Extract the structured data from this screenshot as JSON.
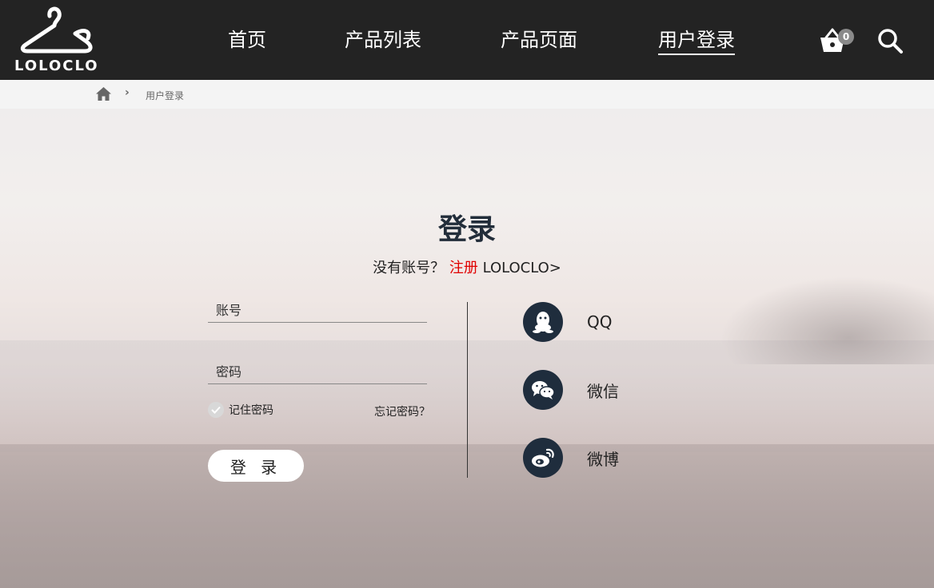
{
  "header": {
    "logo_text": "LOLOCLO",
    "nav": [
      {
        "label": "首页"
      },
      {
        "label": "产品列表"
      },
      {
        "label": "产品页面"
      },
      {
        "label": "用户登录",
        "active": true
      }
    ],
    "cart_count": "0",
    "icons": [
      "hanger-logo-icon",
      "basket-icon",
      "search-icon"
    ]
  },
  "breadcrumb": {
    "home_icon": "home-icon",
    "separator": "›",
    "current": "用户登录"
  },
  "login": {
    "title": "登录",
    "subtitle_prefix": "没有账号？",
    "register_link": "注册",
    "brand_link": "LOLOCLO>",
    "account_placeholder": "账号",
    "password_placeholder": "密码",
    "remember_label": "记住密码",
    "forgot_link": "忘记密码？",
    "submit_label": "登 录"
  },
  "social": [
    {
      "label": "QQ",
      "icon": "qq-icon"
    },
    {
      "label": "微信",
      "icon": "wechat-icon"
    },
    {
      "label": "微博",
      "icon": "weibo-icon"
    }
  ],
  "colors": {
    "header_bg": "#232323",
    "breadcrumb_bg": "#f4f4f4",
    "accent_red": "#e00000",
    "social_icon_bg": "#1f2d3d",
    "title_color": "#222d3a"
  }
}
